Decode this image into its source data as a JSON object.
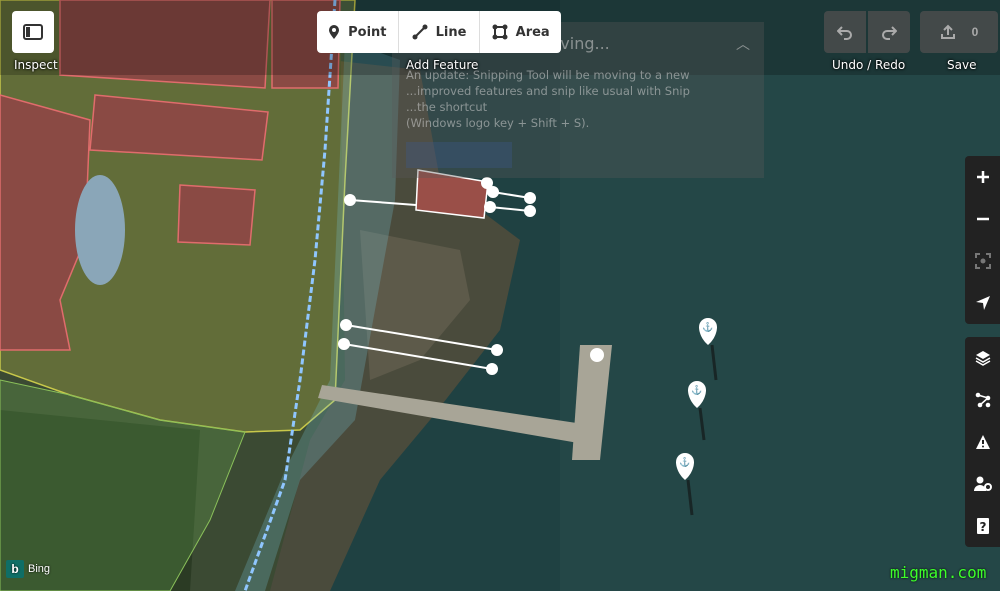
{
  "toolbar": {
    "inspect_label": "Inspect",
    "add_feature_label": "Add Feature",
    "point_label": "Point",
    "line_label": "Line",
    "area_label": "Area",
    "undo_redo_label": "Undo / Redo",
    "save_label": "Save",
    "save_count": "0"
  },
  "notice": {
    "title": "Shipping Tool is moving...",
    "line1": "An update: Snipping Tool will be moving to a new",
    "line2": "...improved features and snip like usual with Snip",
    "line3": "...the shortcut",
    "line4": "(Windows logo key + Shift + S)."
  },
  "map_controls": {
    "zoom_in": "zoom-in",
    "zoom_out": "zoom-out",
    "zoom_to_selection": "zoom-to-selection",
    "geolocate": "geolocate"
  },
  "panel_controls": [
    "background-layers",
    "map-data",
    "issues",
    "preferences",
    "help"
  ],
  "imagery_attribution": "Bing",
  "watermark": "migman.com",
  "colors": {
    "water": "#1f4142",
    "yellow_area": "#c8c84a",
    "blue_line": "#8fc6ff",
    "building_outline": "#e06c6c"
  }
}
